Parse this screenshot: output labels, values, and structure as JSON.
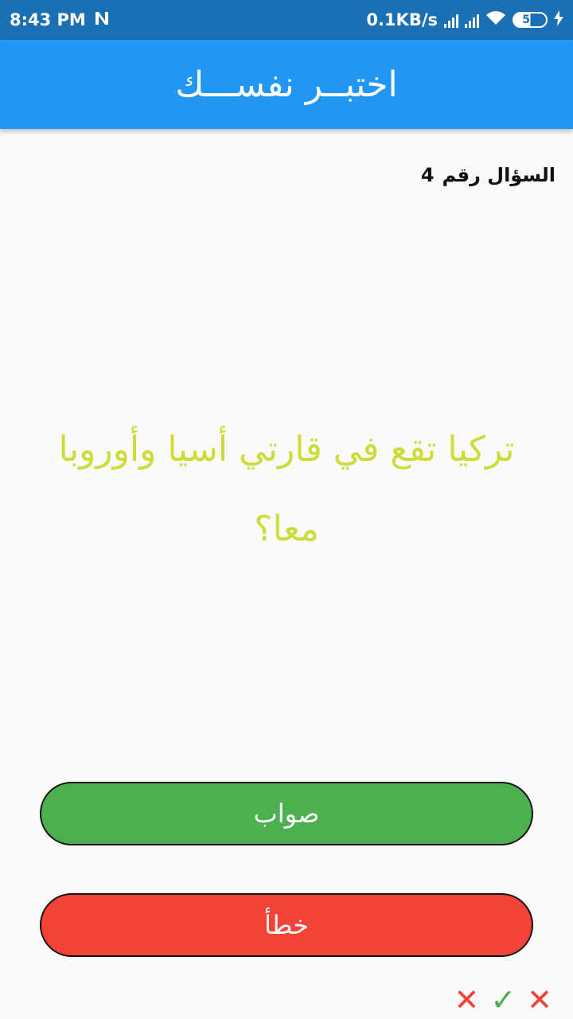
{
  "status_bar": {
    "time": "8:43 PM",
    "speed": "0.1KB/s",
    "battery": "51"
  },
  "app_bar": {
    "title": "اختبــر نفســـك"
  },
  "question": {
    "label": "السؤال رقم",
    "number": "4",
    "text": "تركيا تقع في قارتي أسيا وأوروبا معا؟"
  },
  "buttons": {
    "true_label": "صواب",
    "false_label": "خطأ"
  },
  "score_keeper": {
    "icons": [
      "close-icon",
      "check-icon",
      "close-icon"
    ],
    "symbols": [
      "✕",
      "✓",
      "✕"
    ],
    "colors": {
      "wrong": "#f44336",
      "right": "#4caf50"
    }
  },
  "colors": {
    "status_bar": "#1b6fb4",
    "app_bar": "#2196f3",
    "question_text": "#cddc39",
    "true_button": "#4caf50",
    "false_button": "#f44336"
  }
}
